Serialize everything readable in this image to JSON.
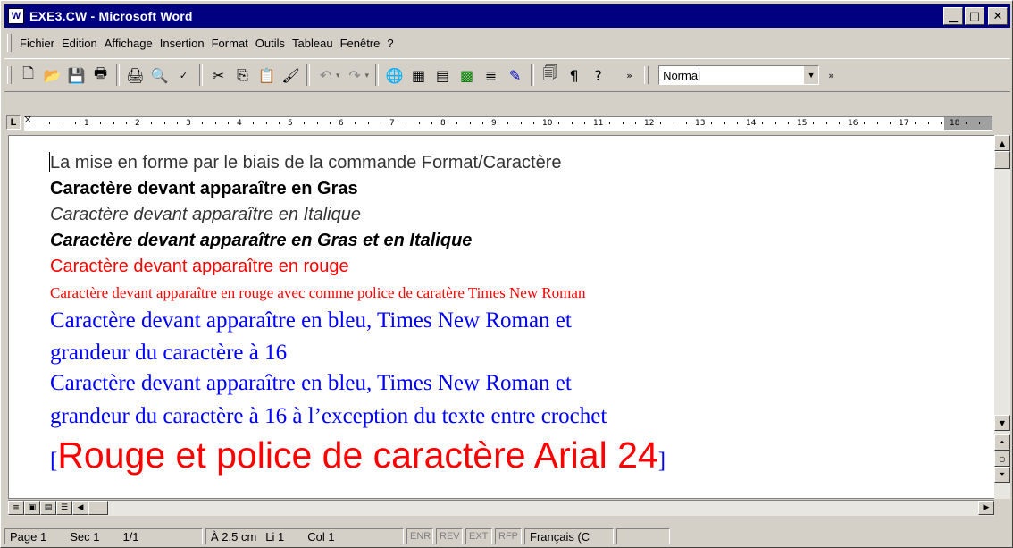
{
  "window": {
    "title": "EXE3.CW - Microsoft Word",
    "app_icon_label": "W",
    "minimize_icon": "minimize-icon",
    "maximize_icon": "maximize-icon",
    "close_icon": "close-icon"
  },
  "menu": {
    "items": [
      "Fichier",
      "Edition",
      "Affichage",
      "Insertion",
      "Format",
      "Outils",
      "Tableau",
      "Fenêtre",
      "?"
    ]
  },
  "toolbar": {
    "style_value": "Normal",
    "icons": [
      "new-document-icon",
      "open-icon",
      "save-icon",
      "permission-icon",
      "print-icon",
      "print-preview-icon",
      "spelling-icon",
      "cut-icon",
      "copy-icon",
      "paste-icon",
      "format-painter-icon",
      "undo-icon",
      "redo-icon",
      "hyperlink-icon",
      "tables-borders-icon",
      "insert-table-icon",
      "insert-excel-icon",
      "columns-icon",
      "drawing-icon",
      "document-map-icon",
      "show-formatting-icon",
      "help-icon"
    ]
  },
  "ruler": {
    "tab_selector": "L",
    "numbers": [
      "1",
      "2",
      "3",
      "4",
      "5",
      "6",
      "7",
      "8",
      "9",
      "10",
      "11",
      "12",
      "13",
      "14",
      "15",
      "16",
      "17",
      "18"
    ]
  },
  "document": {
    "lines": [
      {
        "text": "La mise en forme par le biais de la commande Format/Caractère"
      },
      {
        "text": "Caractère devant apparaître en Gras"
      },
      {
        "text": "Caractère devant apparaître en Italique"
      },
      {
        "text": "Caractère devant apparaître en Gras et en Italique"
      },
      {
        "text": "Caractère devant apparaître en rouge"
      },
      {
        "text": "Caractère devant apparaître en rouge avec comme police de caratère Times New Roman"
      },
      {
        "text": "Caractère devant apparaître en bleu, Times New Roman et"
      },
      {
        "text": "grandeur du caractère à 16"
      },
      {
        "text": "Caractère devant apparaître en bleu, Times New Roman et"
      },
      {
        "text": "grandeur du caractère à 16 à l’exception du texte entre crochet"
      }
    ],
    "bracket_open": "[",
    "bracket_text": "Rouge et police de caractère Arial 24",
    "bracket_close": "]",
    "colors": {
      "red": "#ff0000",
      "blue": "#0000ff",
      "grey": "#333333"
    }
  },
  "status": {
    "page": "Page 1",
    "section": "Sec 1",
    "pages": "1/1",
    "position": "À 2.5 cm",
    "line": "Li 1",
    "column": "Col 1",
    "modes": [
      "ENR",
      "REV",
      "EXT",
      "RFP"
    ],
    "language": "Français (C"
  }
}
